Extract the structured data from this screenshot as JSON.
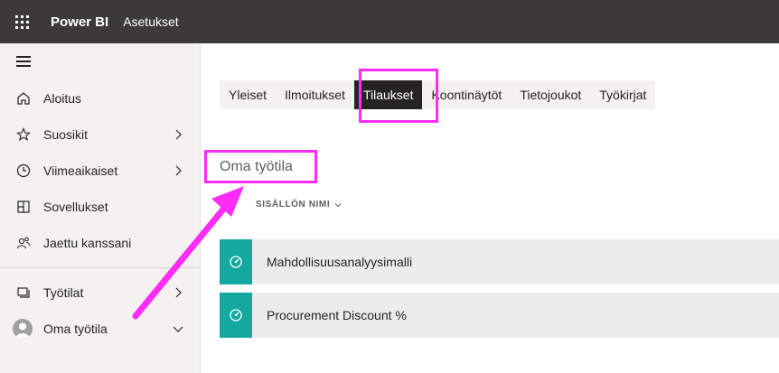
{
  "topbar": {
    "brand": "Power BI",
    "breadcrumb": "Asetukset"
  },
  "nav": {
    "items": [
      {
        "label": "Aloitus",
        "icon": "home-icon"
      },
      {
        "label": "Suosikit",
        "icon": "star-icon"
      },
      {
        "label": "Viimeaikaiset",
        "icon": "clock-icon"
      },
      {
        "label": "Sovellukset",
        "icon": "apps-icon"
      },
      {
        "label": "Jaettu kanssani",
        "icon": "shared-icon"
      },
      {
        "label": "Työtilat",
        "icon": "workspaces-icon"
      },
      {
        "label": "Oma työtila",
        "icon": "avatar"
      }
    ]
  },
  "tabs": [
    "Yleiset",
    "Ilmoitukset",
    "Tilaukset",
    "Koontinäytöt",
    "Tietojoukot",
    "Työkirjat"
  ],
  "active_tab": "Tilaukset",
  "main": {
    "workspace_title": "Oma työtila",
    "column_header": "SISÄLLÖN NIMI",
    "rows": [
      {
        "name": "Mahdollisuusanalyysimalli"
      },
      {
        "name": "Procurement Discount %"
      }
    ]
  },
  "colors": {
    "topbar": "#3b3a39",
    "accent": "#14a9a0",
    "highlight": "#ff2cf7"
  }
}
